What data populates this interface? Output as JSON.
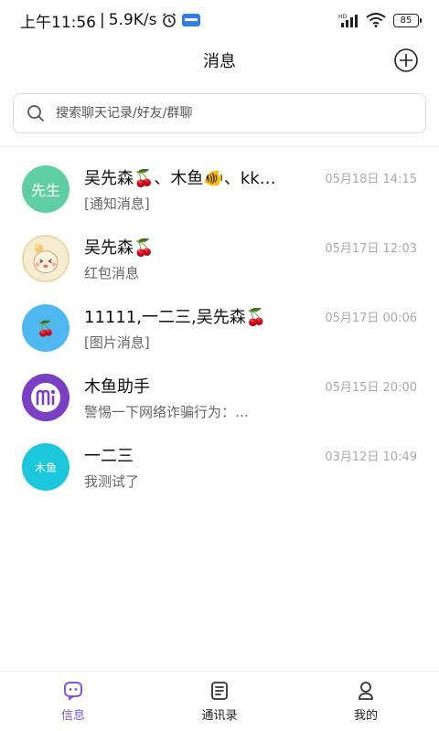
{
  "status_bar": {
    "time": "上午11:56",
    "network_speed": "5.9K/s",
    "battery": "85",
    "icons": [
      "alarm-icon",
      "signal-icon",
      "wifi-icon",
      "battery-icon"
    ]
  },
  "header": {
    "title": "消息",
    "add_icon": "plus-circle-icon"
  },
  "search": {
    "placeholder": "搜索聊天记录/好友/群聊",
    "icon": "search-icon"
  },
  "chats": [
    {
      "name": "吴先森🍒、木鱼🐠、kk…",
      "time": "05月18日 14:15",
      "preview": "[通知消息]",
      "avatar_text": "先生",
      "avatar_color": "#5fcfa3"
    },
    {
      "name": "吴先森🍒",
      "time": "05月17日 12:03",
      "preview": "红包消息",
      "avatar_text": "",
      "avatar_color": "#f3e6c8"
    },
    {
      "name": "11111,一二三,吴先森🍒",
      "time": "05月17日 00:06",
      "preview": "[图片消息]",
      "avatar_text": "🍒",
      "avatar_color": "#4fb8f0"
    },
    {
      "name": "木鱼助手",
      "time": "05月15日 20:00",
      "preview": "警惕一下网络诈骗行为：…",
      "avatar_text": "",
      "avatar_color": "#7b3fc4"
    },
    {
      "name": "一二三",
      "time": "03月12日 10:49",
      "preview": "我测试了",
      "avatar_text": "木鱼",
      "avatar_color": "#1cc7dc"
    }
  ],
  "tabs": [
    {
      "label": "信息",
      "icon": "chat-bubble-icon",
      "active": true
    },
    {
      "label": "通讯录",
      "icon": "contacts-book-icon",
      "active": false
    },
    {
      "label": "我的",
      "icon": "person-icon",
      "active": false
    }
  ],
  "colors": {
    "accent": "#7b57d9"
  }
}
